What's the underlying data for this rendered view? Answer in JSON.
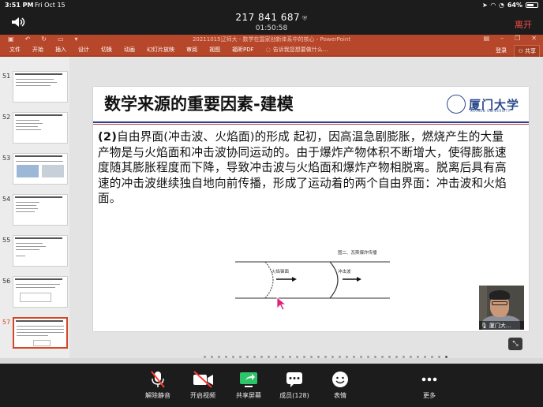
{
  "status_bar": {
    "time": "3:51 PM",
    "date": "Fri Oct 15",
    "battery": "64%",
    "battery_level": 0.64
  },
  "meeting": {
    "id": "217 841 687",
    "duration": "01:50:58",
    "leave_label": "离开"
  },
  "powerpoint": {
    "doc_title": "20211015辽师大 - 数学在国家创新体系中的核心 - PowerPoint",
    "ribbon_tabs": [
      "文件",
      "开始",
      "插入",
      "设计",
      "切换",
      "动画",
      "幻灯片放映",
      "审阅",
      "视图",
      "福昕PDF"
    ],
    "tell_me": "告诉我您想要做什么...",
    "login": "登录",
    "share": "共享",
    "thumbnails": [
      {
        "num": "51",
        "active": false
      },
      {
        "num": "52",
        "active": false
      },
      {
        "num": "53",
        "active": false
      },
      {
        "num": "54",
        "active": false
      },
      {
        "num": "55",
        "active": false
      },
      {
        "num": "56",
        "active": false
      },
      {
        "num": "57",
        "active": true
      }
    ],
    "slide": {
      "title": "数学来源的重要因素-建模",
      "logo_text": "厦门大学",
      "logo_en": "XIAMEN UNIVERSITY",
      "body_prefix": "(2)",
      "body": "自由界面(冲击波、火焰面)的形成  起初，因高温急剧膨胀，燃烧产生的大量产物是与火焰面和冲击波协同运动的。由于爆炸产物体积不断增大，使得膨胀速度随其膨胀程度而下降，导致冲击波与火焰面和爆炸产物相脱离。脱离后具有高速的冲击波继续独自地向前传播，形成了运动着的两个自由界面：冲击波和火焰面。",
      "figure_caption": "图二、瓦斯爆炸传播",
      "label_flame": "火焰锋面",
      "label_shock": "冲击波"
    }
  },
  "participant": {
    "name": "厦门大..."
  },
  "toolbar": {
    "unmute": "解除静音",
    "video": "开启视频",
    "share": "共享屏幕",
    "participants": "成员(128)",
    "reactions": "表情",
    "more": "更多"
  }
}
